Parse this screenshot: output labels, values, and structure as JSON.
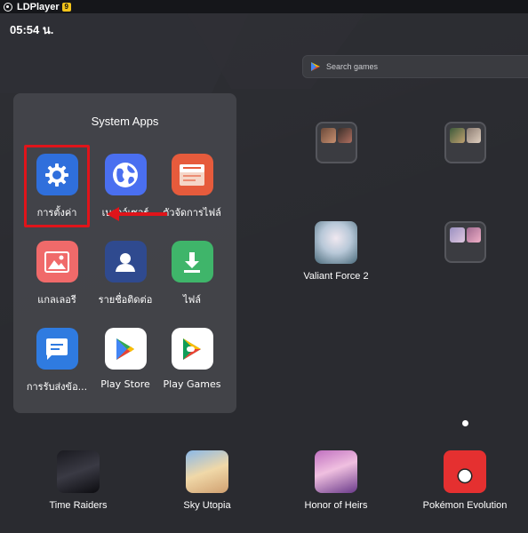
{
  "window": {
    "title": "LDPlayer",
    "badge": "9"
  },
  "status": {
    "time": "05:54 น."
  },
  "search": {
    "placeholder": "Search games"
  },
  "folder": {
    "title": "System Apps",
    "apps": [
      {
        "label": "การตั้งค่า",
        "icon": "settings-gear-icon",
        "color": "#2f6fdc"
      },
      {
        "label": "เบราว์เซอร์",
        "icon": "browser-globe-icon",
        "color": "#4a6ff0"
      },
      {
        "label": "ตัวจัดการไฟล์",
        "icon": "file-manager-icon",
        "color": "#e65b3c"
      },
      {
        "label": "แกลเลอรี",
        "icon": "gallery-image-icon",
        "color": "#f06a6a"
      },
      {
        "label": "รายชื่อติดต่อ",
        "icon": "contacts-person-icon",
        "color": "#2f4a8f"
      },
      {
        "label": "ไฟล์",
        "icon": "files-download-icon",
        "color": "#3fb56a"
      },
      {
        "label": "การรับส่งข้อ...",
        "icon": "messages-icon",
        "color": "#2f7be0"
      },
      {
        "label": "Play Store",
        "icon": "play-store-icon",
        "color": "#ffffff"
      },
      {
        "label": "Play Games",
        "icon": "play-games-icon",
        "color": "#ffffff"
      }
    ]
  },
  "home_games": [
    {
      "label": "Valiant Force 2",
      "icon": "valiant-force-2-art"
    }
  ],
  "dock": [
    {
      "label": "Time Raiders",
      "icon": "time-raiders-art"
    },
    {
      "label": "Sky Utopia",
      "icon": "sky-utopia-art"
    },
    {
      "label": "Honor of Heirs",
      "icon": "honor-of-heirs-art"
    },
    {
      "label": "Pokémon Evolution",
      "icon": "pokemon-evolution-art"
    }
  ]
}
